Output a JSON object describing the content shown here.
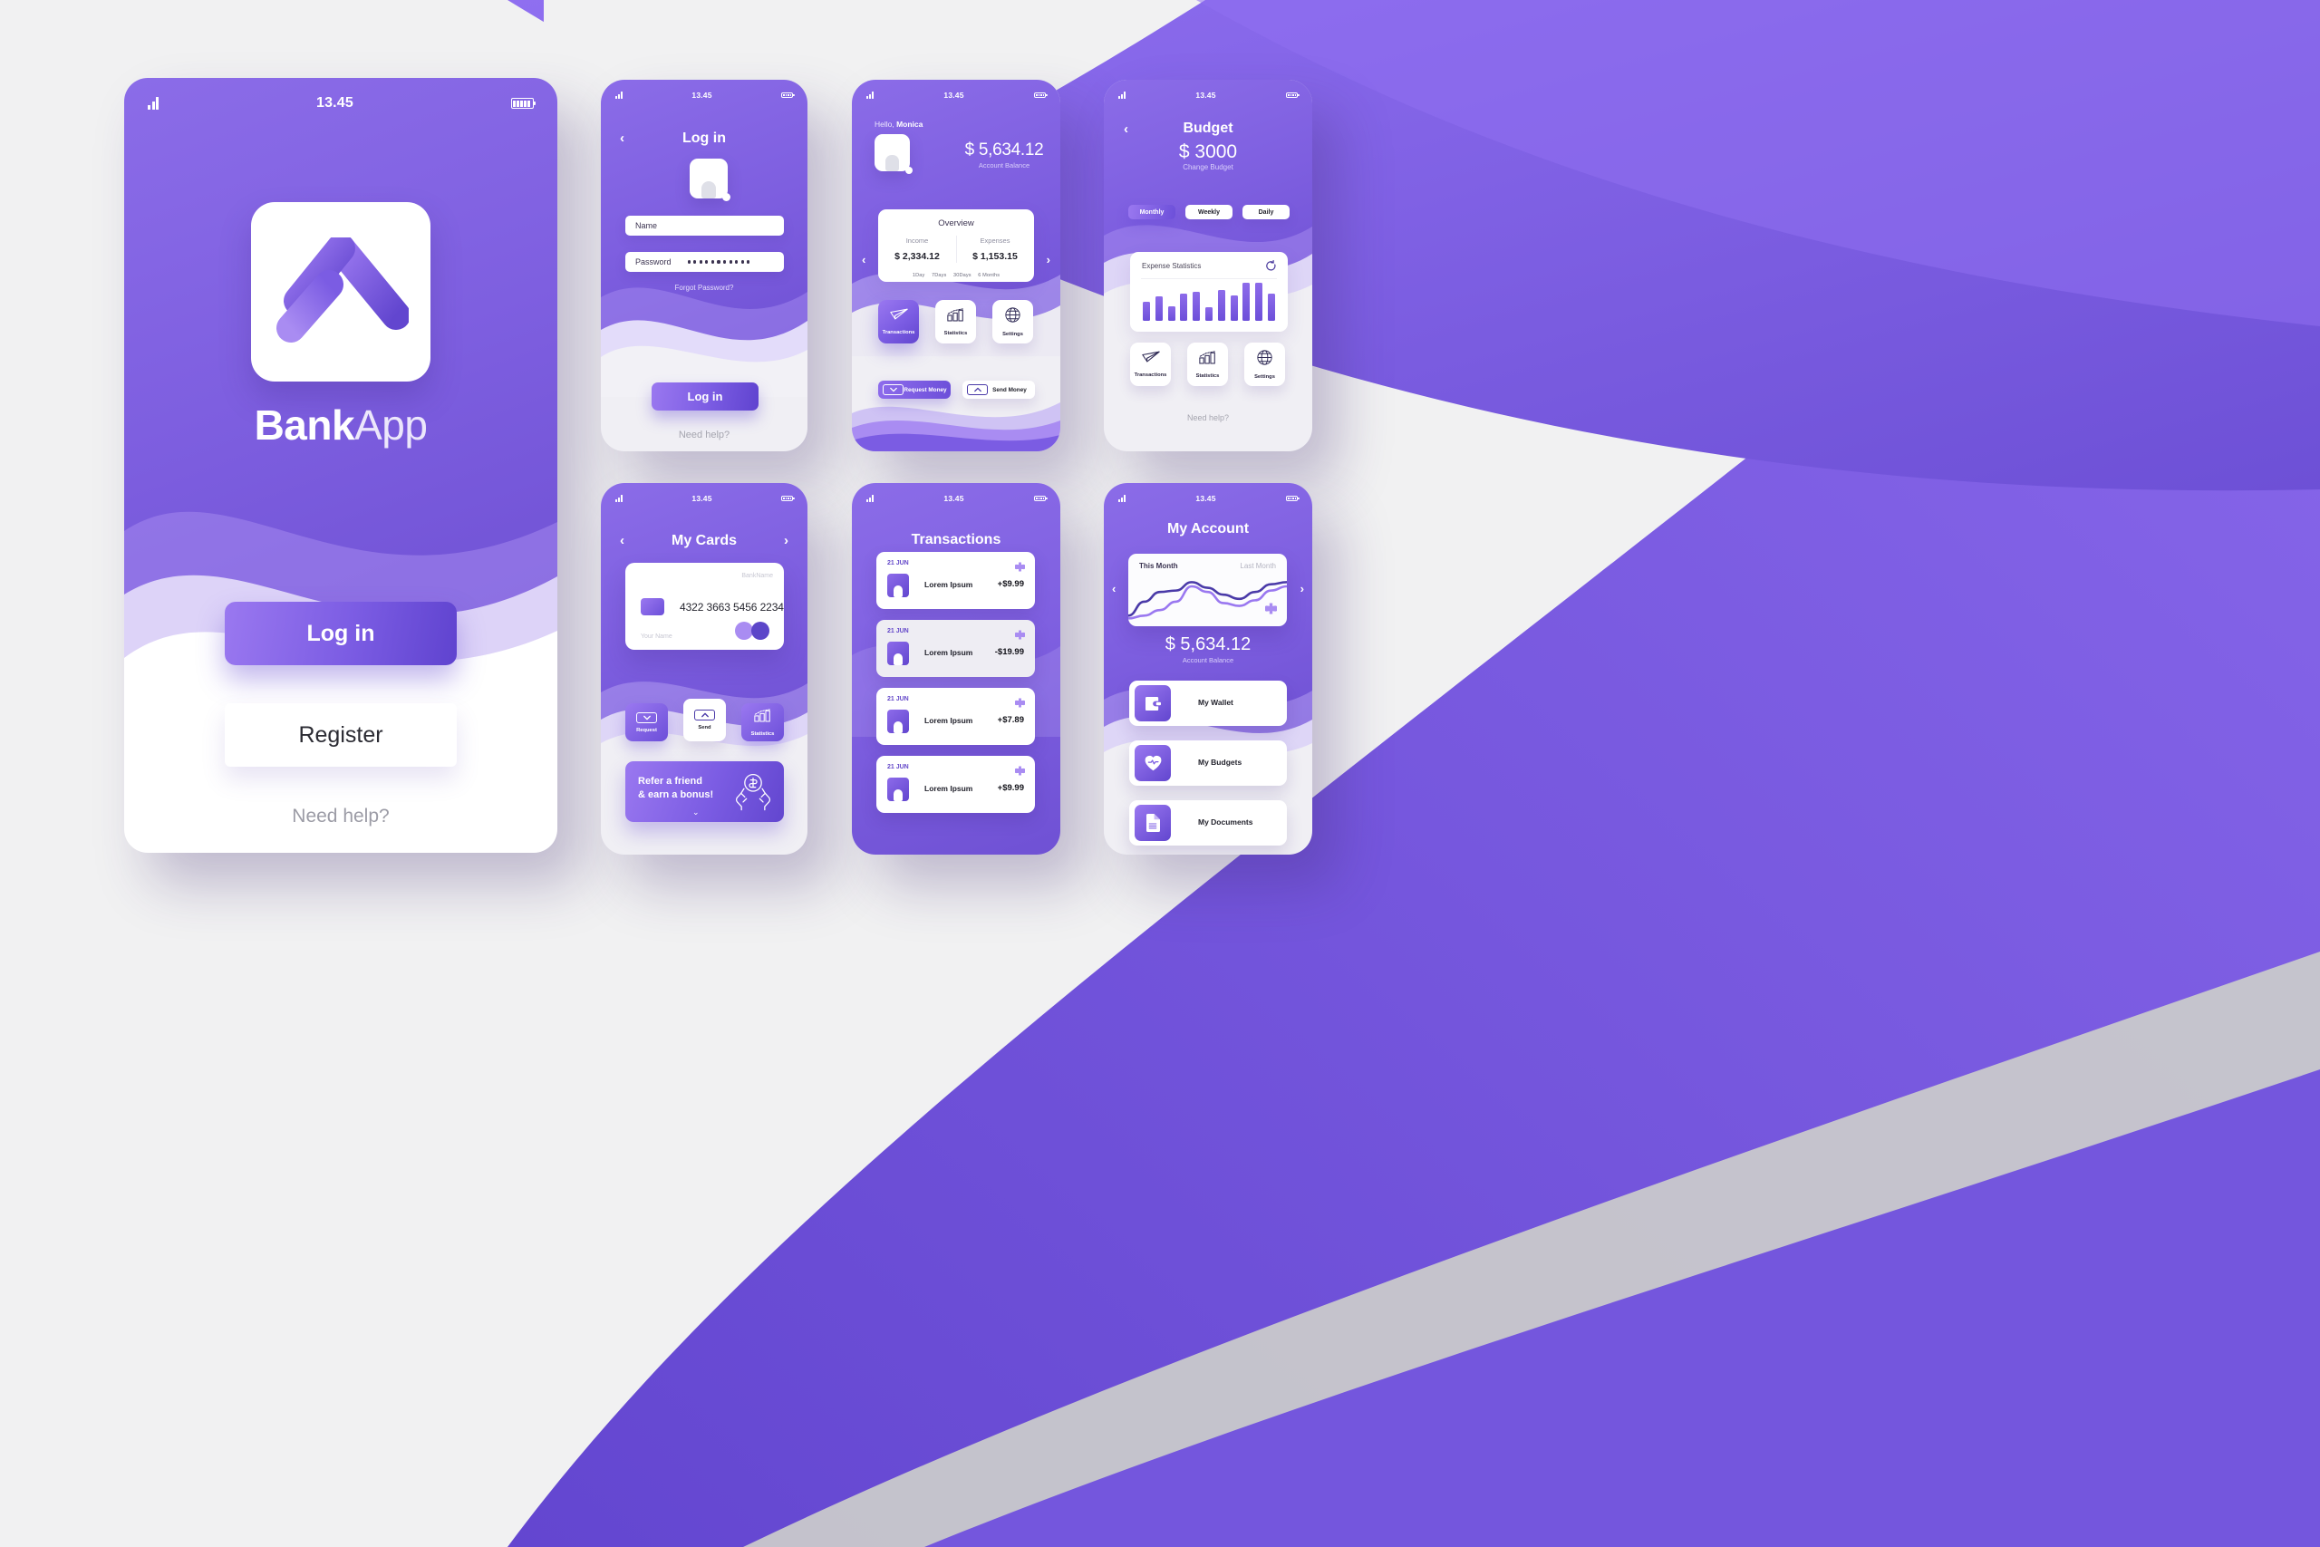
{
  "brand": {
    "name_bold": "Bank",
    "name_light": "App",
    "accent": "#7b5ce3",
    "accent_dark": "#5f43cf",
    "accent_light": "#9a78f0"
  },
  "status_bar": {
    "time": "13.45",
    "signal_icon": "signal-bars-icon",
    "battery_icon": "battery-icon"
  },
  "splash": {
    "logo_icon": "bankapp-chevron-logo",
    "login_label": "Log in",
    "register_label": "Register",
    "help_label": "Need help?"
  },
  "login": {
    "title": "Log in",
    "back_icon": "chevron-left-icon",
    "avatar_icon": "person-avatar-icon",
    "name_label": "Name",
    "name_placeholder": "Name",
    "password_label": "Password",
    "password_masked": "•••••••••••",
    "forgot_label": "Forgot Password?",
    "submit_label": "Log in",
    "help_label": "Need help?"
  },
  "dashboard": {
    "greeting_prefix": "Hello, ",
    "greeting_name": "Monica",
    "avatar_icon": "person-avatar-icon",
    "balance": "$ 5,634.12",
    "balance_label": "Account Balance",
    "overview": {
      "title": "Overview",
      "income_label": "Income",
      "income_value": "$ 2,334.12",
      "expenses_label": "Expenses",
      "expenses_value": "$ 1,153.15",
      "periods": [
        "1Day",
        "7Days",
        "30Days",
        "6 Months"
      ]
    },
    "nav": [
      {
        "label": "Transactions",
        "icon": "paper-plane-icon",
        "active": true
      },
      {
        "label": "Statistics",
        "icon": "bar-chart-icon",
        "active": false
      },
      {
        "label": "Settings",
        "icon": "globe-icon",
        "active": false
      }
    ],
    "request_label": "Request Money",
    "send_label": "Send Money",
    "prev_icon": "chevron-left-icon",
    "next_icon": "chevron-right-icon"
  },
  "budget": {
    "back_icon": "chevron-left-icon",
    "title": "Budget",
    "amount": "$ 3000",
    "change_label": "Change Budget",
    "segments": [
      {
        "label": "Monthly",
        "active": true
      },
      {
        "label": "Weekly",
        "active": false
      },
      {
        "label": "Daily",
        "active": false
      }
    ],
    "chart_title": "Expense Statistics",
    "refresh_icon": "refresh-icon",
    "nav": [
      {
        "label": "Transactions",
        "icon": "paper-plane-icon"
      },
      {
        "label": "Statistics",
        "icon": "bar-chart-icon"
      },
      {
        "label": "Settings",
        "icon": "globe-icon"
      }
    ],
    "help_label": "Need help?"
  },
  "cards": {
    "title": "My Cards",
    "back_icon": "chevron-left-icon",
    "forward_icon": "chevron-right-icon",
    "bank_name": "BankName",
    "card_number": "4322 3663 5456 2234",
    "holder_placeholder": "Your Name",
    "chip_icon": "card-chip-icon",
    "scheme_icon": "dual-circle-scheme-icon",
    "tiles": [
      {
        "label": "Request",
        "icon": "arrow-down-box-icon",
        "style": "purple"
      },
      {
        "label": "Send",
        "icon": "arrow-up-box-icon",
        "style": "white"
      },
      {
        "label": "Statistics",
        "icon": "bar-chart-icon",
        "style": "purple"
      }
    ],
    "refer_line1": "Refer a friend",
    "refer_line2": "& earn a bonus!",
    "refer_icon": "hands-holding-coin-icon",
    "refer_expand_icon": "chevron-down-icon"
  },
  "transactions": {
    "title": "Transactions",
    "rows": [
      {
        "date": "21 JUN",
        "name": "Lorem Ipsum",
        "amount": "+$9.99",
        "dim": false
      },
      {
        "date": "21 JUN",
        "name": "Lorem Ipsum",
        "amount": "-$19.99",
        "dim": true
      },
      {
        "date": "21 JUN",
        "name": "Lorem Ipsum",
        "amount": "+$7.89",
        "dim": false
      },
      {
        "date": "21 JUN",
        "name": "Lorem Ipsum",
        "amount": "+$9.99",
        "dim": false
      }
    ],
    "row_badge_icon": "plus-badge-icon",
    "row_avatar_icon": "person-avatar-icon"
  },
  "account": {
    "title": "My Account",
    "this_month_label": "This Month",
    "last_month_label": "Last Month",
    "graph_badge_icon": "plus-badge-icon",
    "prev_icon": "chevron-left-icon",
    "next_icon": "chevron-right-icon",
    "balance": "$ 5,634.12",
    "balance_label": "Account Balance",
    "menu": [
      {
        "label": "My Wallet",
        "icon": "wallet-icon"
      },
      {
        "label": "My Budgets",
        "icon": "heart-pulse-icon"
      },
      {
        "label": "My Documents",
        "icon": "document-icon"
      }
    ]
  },
  "chart_data": [
    {
      "type": "bar",
      "title": "Expense Statistics",
      "categories": [
        "1",
        "2",
        "3",
        "4",
        "5",
        "6",
        "7",
        "8",
        "9",
        "10",
        "11"
      ],
      "values": [
        26,
        34,
        20,
        38,
        40,
        19,
        43,
        35,
        53,
        52,
        37
      ],
      "xlabel": "",
      "ylabel": "",
      "ylim": [
        0,
        60
      ],
      "grid": false,
      "legend": false,
      "bar_color": "#7b5ce3"
    },
    {
      "type": "line",
      "title": "Account trend",
      "x": [
        0,
        1,
        2,
        3,
        4,
        5,
        6,
        7,
        8,
        9,
        10
      ],
      "series": [
        {
          "name": "This Month",
          "values": [
            10,
            30,
            44,
            46,
            58,
            50,
            40,
            34,
            44,
            55,
            58
          ],
          "color": "#4a3aa8"
        },
        {
          "name": "Last Month",
          "values": [
            6,
            10,
            18,
            30,
            52,
            44,
            28,
            24,
            32,
            46,
            52
          ],
          "color": "#9a78f0"
        }
      ],
      "xlabel": "",
      "ylabel": "",
      "ylim": [
        0,
        65
      ],
      "grid": false,
      "legend": true,
      "legend_position": "top"
    }
  ]
}
